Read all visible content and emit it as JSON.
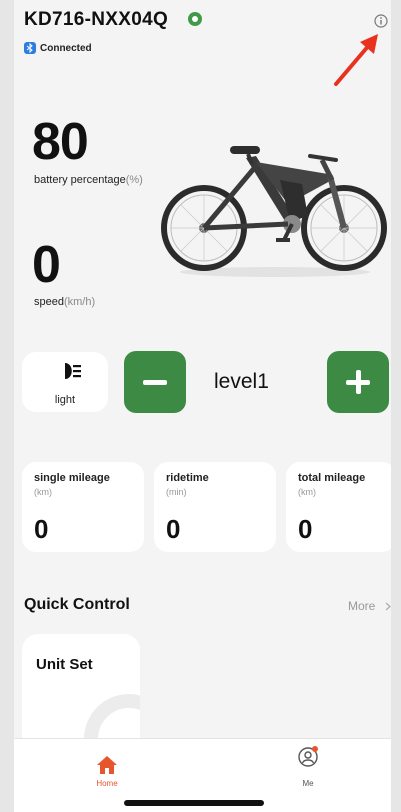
{
  "header": {
    "device_name": "KD716-NXX04Q",
    "connection_status": "Connected",
    "status_dot_color": "#3f9b4a",
    "icons": [
      "bluetooth-icon",
      "info-icon"
    ]
  },
  "annotation": {
    "arrow_color": "#e8321e"
  },
  "metrics": {
    "battery": {
      "value": "80",
      "label": "battery percentage",
      "unit": "(%)"
    },
    "speed": {
      "value": "0",
      "label": "speed",
      "unit": "(km/h)"
    }
  },
  "controls": {
    "light": {
      "label": "light",
      "icon": "headlight-icon"
    },
    "level": {
      "label": "level1"
    },
    "accent_color": "#3d8a45"
  },
  "stats": [
    {
      "title": "single mileage",
      "unit": "(km)",
      "value": "0"
    },
    {
      "title": "ridetime",
      "unit": "(min)",
      "value": "0"
    },
    {
      "title": "total mileage",
      "unit": "(km)",
      "value": "0"
    }
  ],
  "quick_control": {
    "title": "Quick Control",
    "more_label": "More",
    "cards": [
      {
        "title": "Unit Set"
      }
    ]
  },
  "tabbar": {
    "tabs": [
      {
        "label": "Home",
        "icon": "home-icon",
        "active": true,
        "color": "#e7552c"
      },
      {
        "label": "Me",
        "icon": "user-icon",
        "active": false
      }
    ]
  }
}
